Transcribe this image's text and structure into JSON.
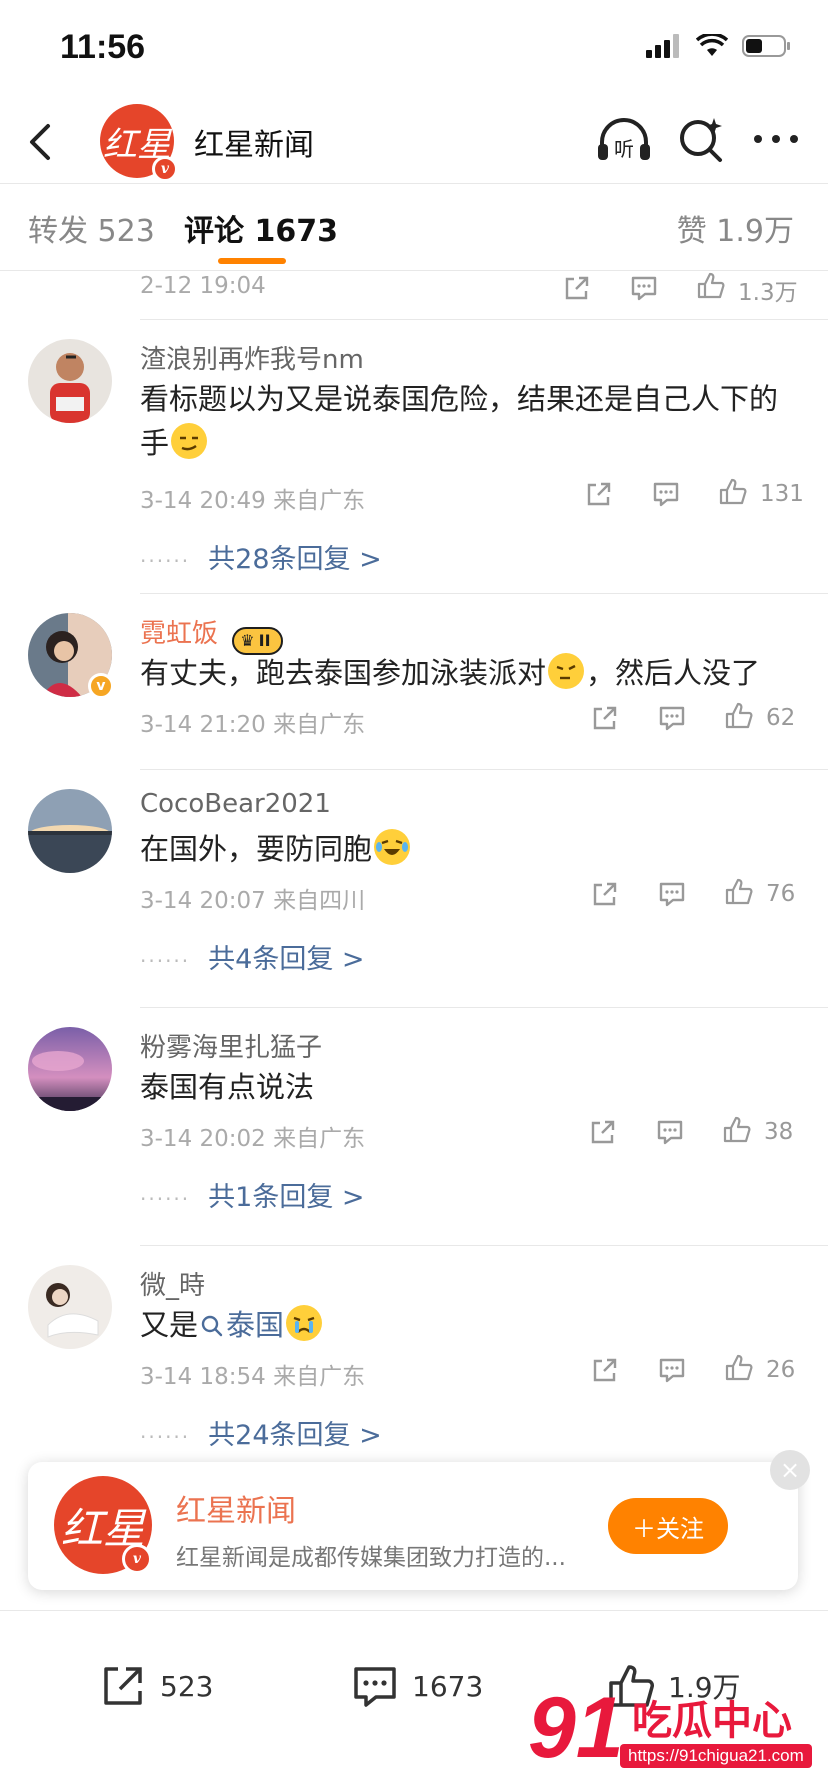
{
  "status": {
    "time": "11:56"
  },
  "nav": {
    "title": "红星新闻",
    "avatar_text": "红星",
    "listen_label": "听"
  },
  "tabs": {
    "repost": "转发 523",
    "comments": "评论 1673",
    "likes": "赞 1.9万"
  },
  "prev_comment": {
    "time": "2-12 19:04",
    "likes": "1.3万"
  },
  "comments": [
    {
      "name": "渣浪别再炸我号nm",
      "text": "看标题以为又是说泰国危险，结果还是自己人下的手",
      "time": "3-14 20:49",
      "location": "来自广东",
      "likes": "131",
      "replies": "共28条回复 >"
    },
    {
      "name": "霓虹饭",
      "badge": "II",
      "text": "有丈夫，跑去泰国参加泳装派对",
      "text_after": "，然后人没了",
      "time": "3-14 21:20",
      "location": "来自广东",
      "likes": "62"
    },
    {
      "name": "CocoBear2021",
      "text": "在国外，要防同胞",
      "time": "3-14 20:07",
      "location": "来自四川",
      "likes": "76",
      "replies": "共4条回复 >"
    },
    {
      "name": "粉雾海里扎猛子",
      "text": "泰国有点说法",
      "time": "3-14 20:02",
      "location": "来自广东",
      "likes": "38",
      "replies": "共1条回复 >"
    },
    {
      "name": "微_時",
      "text_prefix": "又是",
      "topic": "泰国",
      "time": "3-14 18:54",
      "location": "来自广东",
      "likes": "26",
      "replies": "共24条回复 >"
    }
  ],
  "follow_card": {
    "name": "红星新闻",
    "desc": "红星新闻是成都传媒集团致力打造的...",
    "button": "＋关注",
    "close": "×",
    "avatar_text": "红星"
  },
  "bottom_bar": {
    "reposts": "523",
    "comments": "1673",
    "likes": "1.9万"
  },
  "watermark": {
    "brand_num": "91",
    "brand_text": "吃瓜中心",
    "url": "https://91chigua21.com"
  },
  "colors": {
    "accent": "#ff8200",
    "link": "#4b6c9a",
    "vip_name": "#eb7350",
    "brand_red": "#e5452a"
  }
}
